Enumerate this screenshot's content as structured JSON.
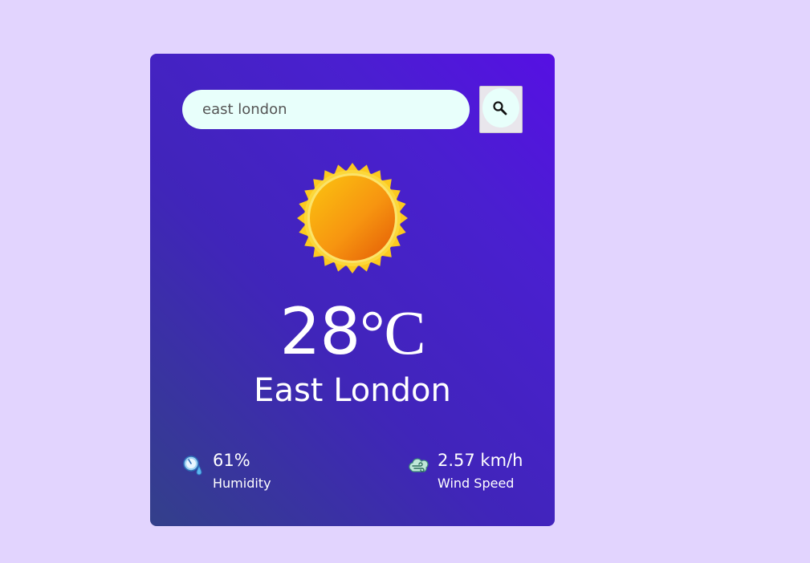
{
  "search": {
    "value": "east london",
    "placeholder": "",
    "button_icon": "search-icon"
  },
  "weather": {
    "icon": "sun-icon",
    "temperature": "28",
    "unit": "°C",
    "city": "East London"
  },
  "details": {
    "humidity": {
      "icon": "humidity-icon",
      "value": "61%",
      "label": "Humidity"
    },
    "wind": {
      "icon": "wind-icon",
      "value": "2.57 km/h",
      "label": "Wind Speed"
    }
  },
  "colors": {
    "page_background": "#e2d4fe",
    "card_gradient_top": "#5610e3",
    "card_gradient_bottom": "#33408a",
    "input_background": "#e8fffb",
    "text": "#ffffff"
  }
}
